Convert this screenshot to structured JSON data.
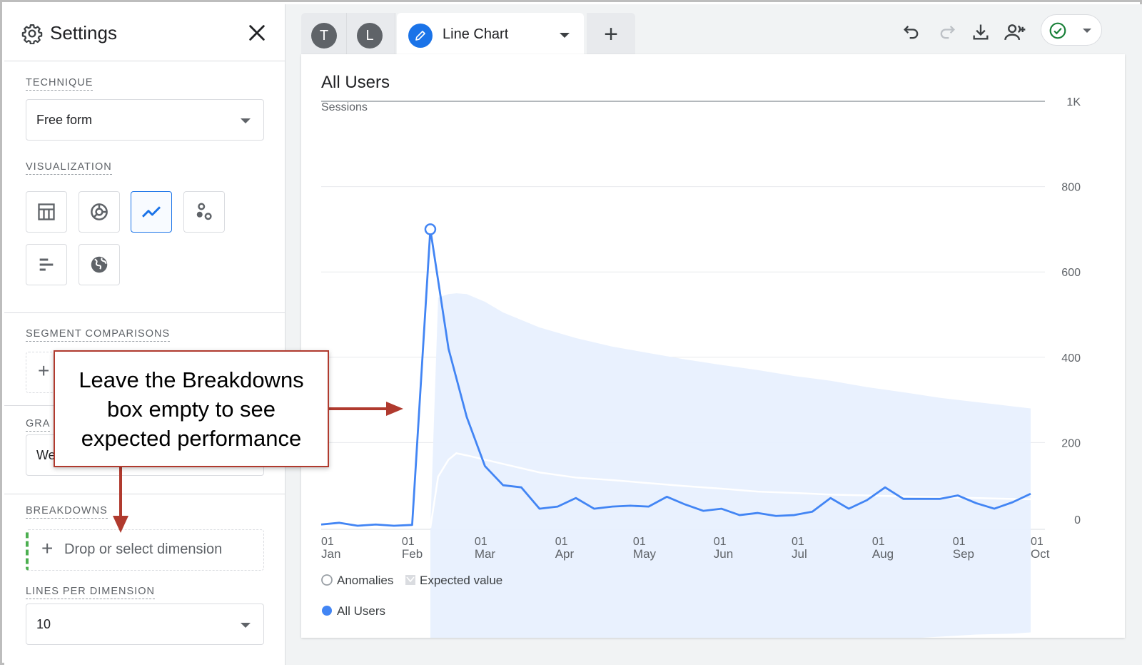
{
  "sidebar": {
    "title": "Settings",
    "technique": {
      "label": "TECHNIQUE",
      "value": "Free form"
    },
    "visualization": {
      "label": "VISUALIZATION",
      "options": [
        "table-icon",
        "donut-chart-icon",
        "line-chart-icon",
        "scatter-plot-icon",
        "bar-chart-icon",
        "geo-map-icon"
      ],
      "selected": "line-chart-icon"
    },
    "segment_comparisons": {
      "label": "SEGMENT COMPARISONS",
      "add": "+"
    },
    "granularity": {
      "label": "GRA",
      "value": "We"
    },
    "breakdowns": {
      "label": "BREAKDOWNS",
      "placeholder": "Drop or select dimension",
      "plus": "+"
    },
    "lines_per_dimension": {
      "label": "LINES PER DIMENSION",
      "value": "10"
    }
  },
  "tabs": {
    "avatars": [
      "T",
      "L"
    ],
    "active_label": "Line Chart",
    "add": "+"
  },
  "toolbar": {
    "icons": [
      "undo-icon",
      "redo-icon",
      "download-icon",
      "share-user-icon",
      "check-circle-icon"
    ]
  },
  "callout": {
    "text": "Leave the Breakdowns box empty to see expected performance",
    "color": "#b03a2e"
  },
  "chart": {
    "title": "All Users",
    "subtitle": "Sessions",
    "legend": {
      "anomalies": "Anomalies",
      "expected": "Expected value",
      "series": "All Users"
    }
  },
  "chart_data": {
    "type": "line",
    "title": "All Users",
    "ylabel": "Sessions",
    "ylim": [
      0,
      1000
    ],
    "yticks": [
      {
        "value": 0,
        "label": "0"
      },
      {
        "value": 200,
        "label": "200"
      },
      {
        "value": 400,
        "label": "400"
      },
      {
        "value": 600,
        "label": "600"
      },
      {
        "value": 800,
        "label": "800"
      },
      {
        "value": 1000,
        "label": "1K"
      }
    ],
    "xticks": [
      {
        "day": 0,
        "l1": "01",
        "l2": "Jan"
      },
      {
        "day": 31,
        "l1": "01",
        "l2": "Feb"
      },
      {
        "day": 59,
        "l1": "01",
        "l2": "Mar"
      },
      {
        "day": 90,
        "l1": "01",
        "l2": "Apr"
      },
      {
        "day": 120,
        "l1": "01",
        "l2": "May"
      },
      {
        "day": 151,
        "l1": "01",
        "l2": "Jun"
      },
      {
        "day": 181,
        "l1": "01",
        "l2": "Jul"
      },
      {
        "day": 212,
        "l1": "01",
        "l2": "Aug"
      },
      {
        "day": 243,
        "l1": "01",
        "l2": "Sep"
      },
      {
        "day": 273,
        "l1": "01",
        "l2": "Oct"
      }
    ],
    "series": [
      {
        "name": "All Users",
        "color": "#4285f4",
        "x": [
          0,
          7,
          14,
          21,
          28,
          35,
          42,
          49,
          56,
          63,
          70,
          77,
          84,
          91,
          98,
          105,
          112,
          119,
          126,
          133,
          140,
          147,
          154,
          161,
          168,
          175,
          182,
          189,
          196,
          203,
          210,
          217,
          224,
          231,
          238,
          245,
          252,
          259,
          266,
          273
        ],
        "y": [
          8,
          12,
          5,
          8,
          5,
          7,
          700,
          420,
          260,
          145,
          100,
          95,
          45,
          50,
          70,
          45,
          50,
          52,
          50,
          73,
          55,
          40,
          45,
          30,
          35,
          28,
          30,
          38,
          70,
          45,
          65,
          95,
          68,
          68,
          68,
          76,
          58,
          45,
          60,
          80
        ]
      }
    ],
    "expected": {
      "name": "Expected value",
      "x": [
        42,
        45,
        49,
        52,
        56,
        63,
        70,
        84,
        98,
        112,
        126,
        140,
        154,
        168,
        182,
        196,
        210,
        224,
        238,
        252,
        266,
        273
      ],
      "y": [
        0,
        120,
        160,
        175,
        170,
        160,
        150,
        130,
        118,
        112,
        105,
        98,
        92,
        85,
        82,
        78,
        76,
        74,
        72,
        70,
        68,
        67
      ],
      "upper": [
        0,
        540,
        548,
        550,
        548,
        530,
        505,
        470,
        445,
        425,
        410,
        395,
        382,
        370,
        356,
        345,
        330,
        318,
        305,
        295,
        285,
        280
      ],
      "lower": [
        -300,
        -305,
        -300,
        -290,
        -285,
        -280,
        -280,
        -280,
        -280,
        -280,
        -280,
        -280,
        -280,
        -275,
        -275,
        -270,
        -265,
        -260,
        -255,
        -250,
        -248,
        -245
      ]
    },
    "anomalies": [
      {
        "x": 42,
        "y": 700
      }
    ],
    "legend": [
      "Anomalies",
      "Expected value",
      "All Users"
    ],
    "legend_position": "bottom-left"
  }
}
